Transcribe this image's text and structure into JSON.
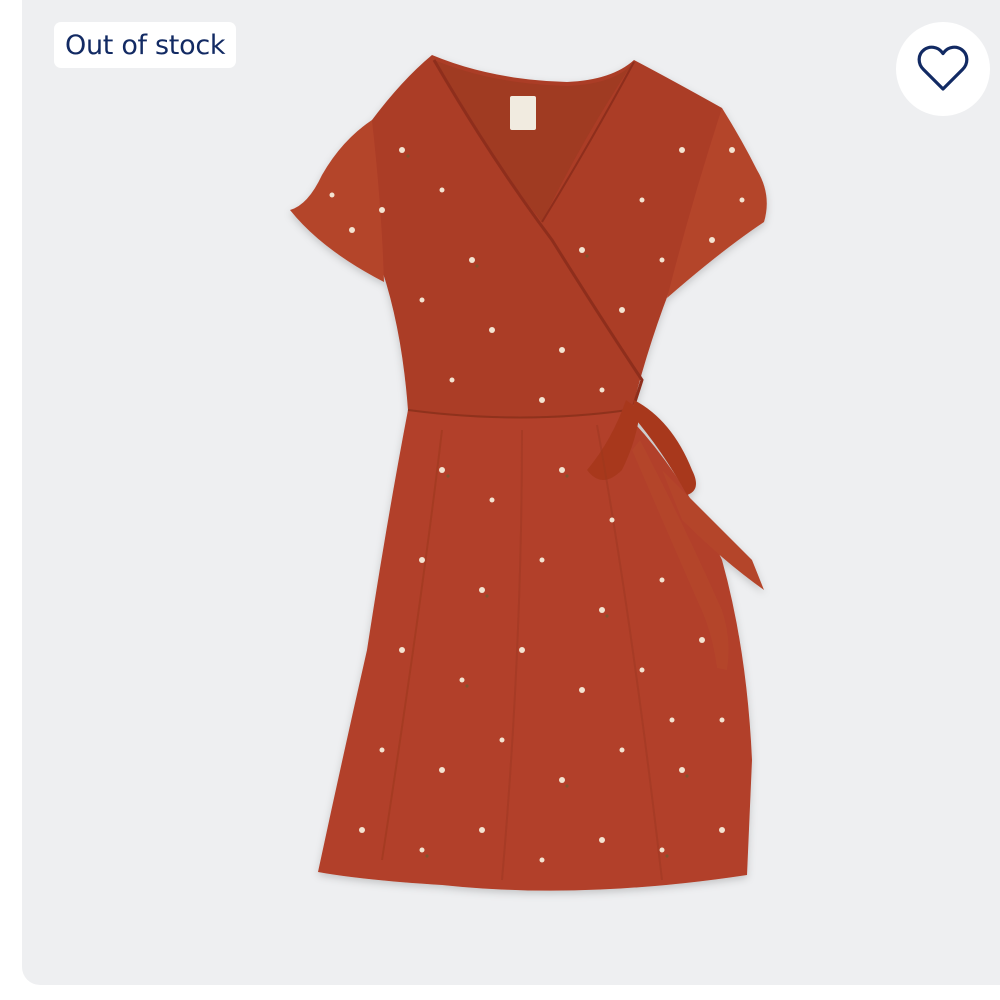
{
  "product_card": {
    "status_badge": "Out of stock",
    "favorite_icon": "heart-outline-icon",
    "image": {
      "subject": "dress-image",
      "dress_color": "#b2412a",
      "print_color": "#f3e4d2"
    }
  },
  "colors": {
    "card_background": "#eeeff1",
    "badge_text": "#122a63",
    "badge_background": "#ffffff",
    "heart_stroke": "#122a63"
  }
}
